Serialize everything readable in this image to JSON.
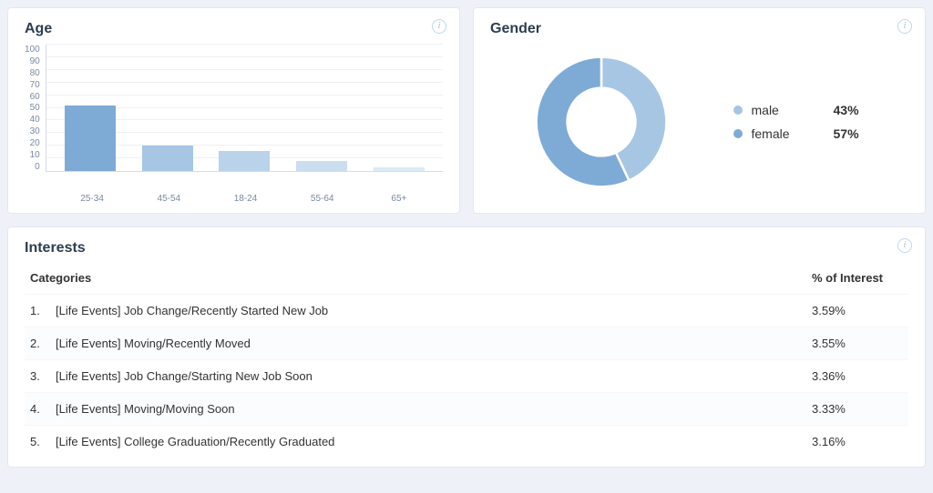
{
  "colors": {
    "bar_shades": [
      "#7eaad6",
      "#a6c6e4",
      "#b9d3ea",
      "#cadef0",
      "#daeaf6"
    ],
    "male": "#a6c6e4",
    "female": "#7eaad6"
  },
  "age": {
    "title": "Age"
  },
  "gender": {
    "title": "Gender",
    "legend": [
      {
        "label": "male",
        "pct_label": "43%",
        "color_key": "male"
      },
      {
        "label": "female",
        "pct_label": "57%",
        "color_key": "female"
      }
    ]
  },
  "interests": {
    "title": "Interests",
    "col_categories": "Categories",
    "col_pct": "% of Interest",
    "rows": [
      {
        "rank": "1.",
        "label": "[Life Events] Job Change/Recently Started New Job",
        "pct": "3.59%"
      },
      {
        "rank": "2.",
        "label": "[Life Events] Moving/Recently Moved",
        "pct": "3.55%"
      },
      {
        "rank": "3.",
        "label": "[Life Events] Job Change/Starting New Job Soon",
        "pct": "3.36%"
      },
      {
        "rank": "4.",
        "label": "[Life Events] Moving/Moving Soon",
        "pct": "3.33%"
      },
      {
        "rank": "5.",
        "label": "[Life Events] College Graduation/Recently Graduated",
        "pct": "3.16%"
      }
    ]
  },
  "chart_data": [
    {
      "type": "bar",
      "title": "Age",
      "xlabel": "",
      "ylabel": "",
      "ylim": [
        0,
        100
      ],
      "y_ticks": [
        0,
        10,
        20,
        30,
        40,
        50,
        60,
        70,
        80,
        90,
        100
      ],
      "categories": [
        "25-34",
        "45-54",
        "18-24",
        "55-64",
        "65+"
      ],
      "values": [
        52,
        20,
        16,
        8,
        3
      ]
    },
    {
      "type": "pie",
      "title": "Gender",
      "series": [
        {
          "name": "male",
          "value": 43
        },
        {
          "name": "female",
          "value": 57
        }
      ]
    },
    {
      "type": "table",
      "title": "Interests",
      "columns": [
        "Categories",
        "% of Interest"
      ],
      "rows": [
        [
          "[Life Events] Job Change/Recently Started New Job",
          3.59
        ],
        [
          "[Life Events] Moving/Recently Moved",
          3.55
        ],
        [
          "[Life Events] Job Change/Starting New Job Soon",
          3.36
        ],
        [
          "[Life Events] Moving/Moving Soon",
          3.33
        ],
        [
          "[Life Events] College Graduation/Recently Graduated",
          3.16
        ]
      ]
    }
  ]
}
